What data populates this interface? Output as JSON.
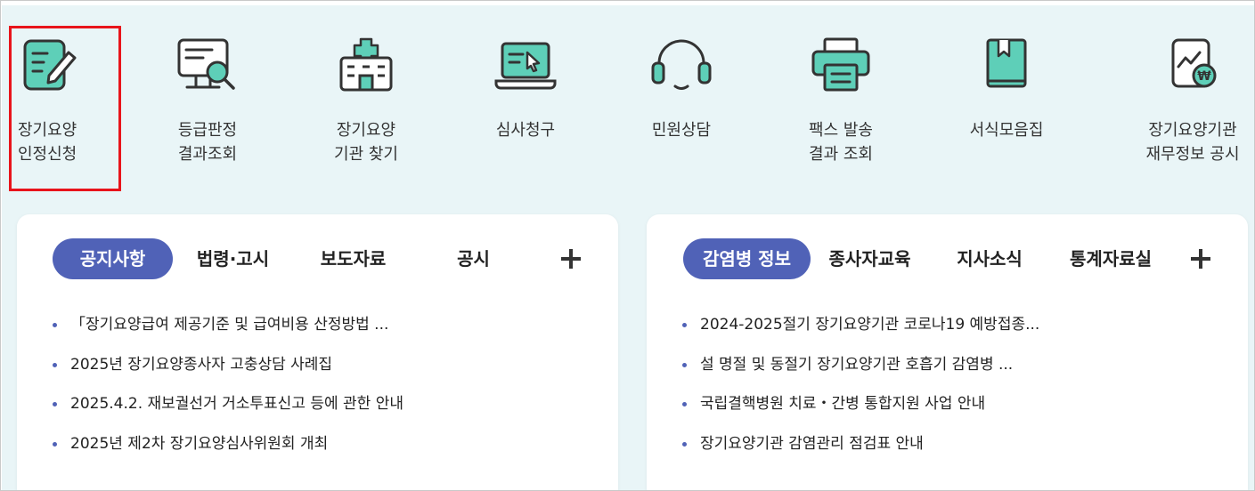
{
  "quick_menu": [
    {
      "label": "장기요양\n인정신청",
      "icon": "document-pen-icon"
    },
    {
      "label": "등급판정\n결과조회",
      "icon": "monitor-search-icon"
    },
    {
      "label": "장기요양\n기관 찾기",
      "icon": "hospital-building-icon"
    },
    {
      "label": "심사청구",
      "icon": "laptop-cursor-icon"
    },
    {
      "label": "민원상담",
      "icon": "headset-icon"
    },
    {
      "label": "팩스 발송\n결과 조회",
      "icon": "fax-printer-icon"
    },
    {
      "label": "서식모음집",
      "icon": "book-icon"
    },
    {
      "label": "장기요양기관\n재무정보 공시",
      "icon": "document-chart-won-icon"
    }
  ],
  "left_panel": {
    "tabs": [
      "공지사항",
      "법령·고시",
      "보도자료",
      "공시"
    ],
    "active_tab": "공지사항",
    "items": [
      "「장기요양급여 제공기준 및 급여비용 산정방법 ...",
      "2025년 장기요양종사자 고충상담 사례집",
      "2025.4.2. 재보궐선거 거소투표신고 등에 관한 안내",
      "2025년 제2차 장기요양심사위원회 개최"
    ]
  },
  "right_panel": {
    "tabs": [
      "감염병 정보",
      "종사자교육",
      "지사소식",
      "통계자료실"
    ],
    "active_tab": "감염병 정보",
    "items": [
      "2024-2025절기 장기요양기관 코로나19 예방접종...",
      "설 명절 및 동절기 장기요양기관 호흡기 감염병 ...",
      "국립결핵병원 치료・간병 통합지원 사업 안내",
      "장기요양기관 감염관리 점검표 안내"
    ]
  },
  "colors": {
    "background": "#e9f5f7",
    "accent": "#5062b7",
    "icon_fill": "#5ecfb8",
    "icon_stroke": "#333333",
    "highlight": "#e8141b"
  }
}
